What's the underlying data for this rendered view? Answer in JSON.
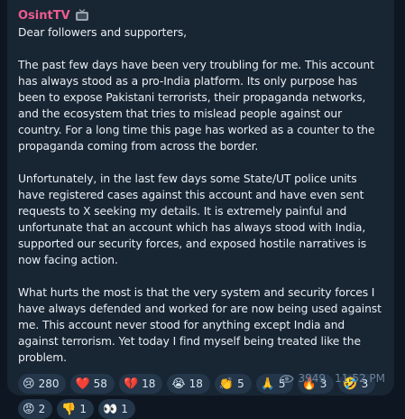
{
  "message": {
    "sender": "OsintTV",
    "sender_icon": "tv-icon",
    "text": "Dear followers and supporters,\n\nThe past few days have been very troubling for me. This account has always stood as a pro-India platform. Its only purpose has been to expose Pakistani terrorists, their propaganda networks, and the ecosystem that tries to mislead people against our country. For a long time this page has worked as a counter to the propaganda coming from across the border.\n\nUnfortunately, in the last few days some State/UT police units have registered cases against this account and have even sent requests to X seeking my details. It is extremely painful and unfortunate that an account which has always stood with India, supported our security forces, and exposed hostile narratives is now facing action.\n\nWhat hurts the most is that the very system and security forces I have always defended and worked for are now being used against me. This account never stood for anything except India and against terrorism. Yet today I find myself being treated like the problem.",
    "views": "3949",
    "time": "11:52 PM"
  },
  "reactions": [
    {
      "emoji": "😢",
      "count": "280"
    },
    {
      "emoji": "❤️",
      "count": "58"
    },
    {
      "emoji": "💔",
      "count": "18"
    },
    {
      "emoji": "😭",
      "count": "18"
    },
    {
      "emoji": "👏",
      "count": "5"
    },
    {
      "emoji": "🙏",
      "count": "5"
    },
    {
      "emoji": "🔥",
      "count": "3"
    },
    {
      "emoji": "🤣",
      "count": "3"
    },
    {
      "emoji": "😡",
      "count": "2"
    },
    {
      "emoji": "👎",
      "count": "1"
    },
    {
      "emoji": "👀",
      "count": "1"
    }
  ],
  "colors": {
    "background": "#0e1621",
    "bubble": "#182533",
    "sender": "#ee5b8f",
    "reaction_bg": "#23364a",
    "meta": "#6d8297"
  }
}
